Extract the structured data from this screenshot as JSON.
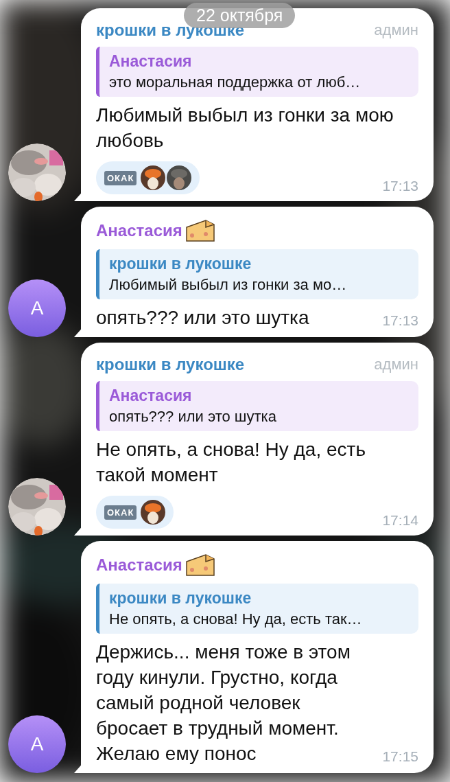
{
  "date_pill": "22 октября",
  "messages": [
    {
      "avatar": {
        "kind": "picture"
      },
      "sender": {
        "name": "крошки в лукошке",
        "kind": "channel",
        "emoji": false
      },
      "badge": "админ",
      "reply": {
        "kind": "user",
        "name": "Анастасия",
        "text": "это моральная поддержка от люб…"
      },
      "text": "Любимый выбыл из гонки за мою любовь",
      "reactions": [
        {
          "emoji": "ОКАК",
          "reactors": [
            {
              "kind": "picture"
            },
            {
              "kind": "picture"
            }
          ]
        }
      ],
      "time": "17:13"
    },
    {
      "avatar": {
        "kind": "letter",
        "letter": "А"
      },
      "sender": {
        "name": "Анастасия",
        "kind": "user",
        "emoji": true
      },
      "reply": {
        "kind": "channel",
        "name": "крошки в лукошке",
        "text": "Любимый выбыл из гонки за мо…"
      },
      "text": "опять??? или это шутка",
      "time": "17:13"
    },
    {
      "avatar": {
        "kind": "picture"
      },
      "sender": {
        "name": "крошки в лукошке",
        "kind": "channel",
        "emoji": false
      },
      "badge": "админ",
      "reply": {
        "kind": "user",
        "name": "Анастасия",
        "text": "опять??? или это шутка"
      },
      "text": "Не опять, а снова! Ну да, есть такой момент",
      "reactions": [
        {
          "emoji": "ОКАК",
          "reactors": [
            {
              "kind": "picture"
            }
          ]
        }
      ],
      "time": "17:14"
    },
    {
      "avatar": {
        "kind": "letter",
        "letter": "А"
      },
      "sender": {
        "name": "Анастасия",
        "kind": "user",
        "emoji": true
      },
      "reply": {
        "kind": "channel",
        "name": "крошки в лукошке",
        "text": "Не опять, а снова! Ну да, есть так…"
      },
      "text": "Держись... меня тоже в этом году кинули. Грустно, когда самый родной человек бросает в трудный момент. Желаю ему понос",
      "time": "17:15"
    }
  ]
}
